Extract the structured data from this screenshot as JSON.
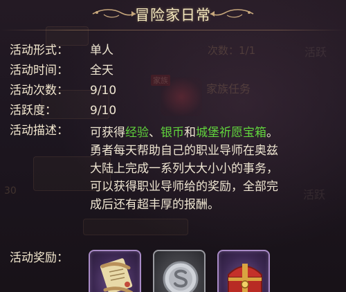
{
  "title": "冒险家日常",
  "info": {
    "form": {
      "label": "活动形式：",
      "value": "单人"
    },
    "time": {
      "label": "活动时间：",
      "value": "全天"
    },
    "count": {
      "label": "活动次数：",
      "value": "9/10"
    },
    "activity": {
      "label": "活跃度：",
      "value": "9/10"
    }
  },
  "description": {
    "label": "活动描述：",
    "line1_prefix": "可获得",
    "reward1": "经验",
    "sep1": "、",
    "reward2": "银币",
    "sep2": "和",
    "reward3": "城堡祈愿宝箱",
    "line1_suffix": "。",
    "line2": "勇者每天帮助自己的职业导师在奥兹",
    "line3": "大陆上完成一系列大大小小的事务，",
    "line4": "可以获得职业导师给的奖励，全部完",
    "line5": "成后还有超丰厚的报酬。"
  },
  "rewards": {
    "label": "活动奖励：",
    "items": [
      {
        "icon": "scroll-icon",
        "border": "#a98bc7"
      },
      {
        "icon": "silver-coin-icon",
        "border": "#9a9aa0"
      },
      {
        "icon": "treasure-chest-icon",
        "border": "#a98bc7"
      }
    ]
  },
  "colors": {
    "title": "#f3e7bd",
    "label": "#f3e8cf",
    "highlight": "#61d43d",
    "background": "#1d1620"
  }
}
